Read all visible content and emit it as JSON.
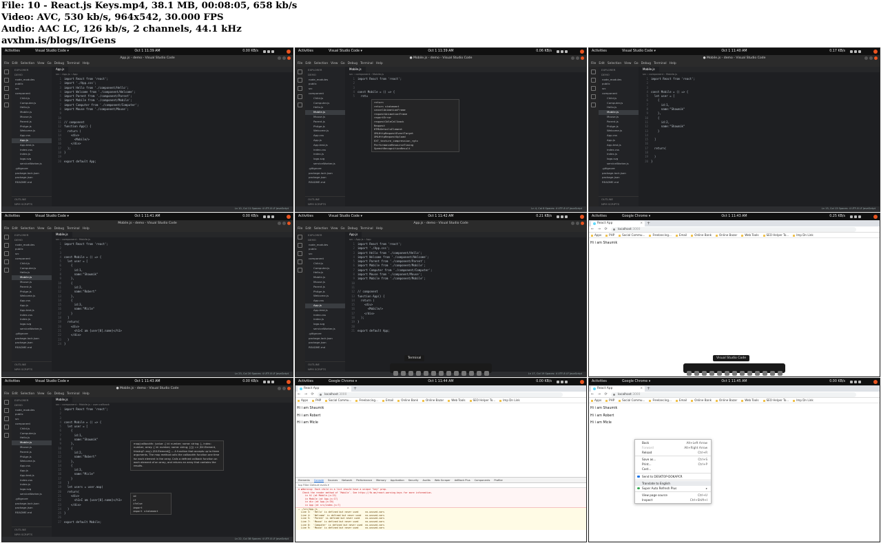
{
  "header": {
    "file": "File: 10 - React.js Keys.mp4, 38.1 MB, 00:08:05, 658 kb/s",
    "video": "Video: AVC, 530 kb/s, 964x542, 30.000 FPS",
    "audio": "Audio: AAC LC, 126 kb/s, 2 channels, 44.1 kHz",
    "site": "avxhm.is/blogs/IrGens"
  },
  "os": {
    "activities": "Activities",
    "vscode_app": "Visual Studio Code ▾",
    "chrome_app": "Google Chrome ▾"
  },
  "vscode": {
    "menu": [
      "File",
      "Edit",
      "Selection",
      "View",
      "Go",
      "Debug",
      "Terminal",
      "Help"
    ],
    "explorer_label": "EXPLORER",
    "outline": "OUTLINE",
    "npm_scripts": "NPM SCRIPTS"
  },
  "chrome": {
    "tab_title": "React App",
    "url_host": "localhost",
    "url_port": ":3000",
    "bookmarks": [
      "Apps",
      "PHP",
      "Social Commu...",
      "Freelancing...",
      "Email",
      "Online Bank",
      "Online Bazar",
      "Web Tools",
      "SEO Helper To...",
      "Imp Dn Link"
    ]
  },
  "t1": {
    "clock": "Oct 1 11:39 AM",
    "net": "0.00 KB/s",
    "title": "App.js - demo - Visual Studio Code",
    "tab": "App.js",
    "crumb": "src › App.js › App",
    "status": "Ln 10, Col 11   Spaces: 4   UTF-8   LF   JavaScript",
    "code": [
      "import React from 'react';",
      "import './App.css';",
      "import Hello from './component/Hello';",
      "import Welcome from './component/Welcome';",
      "import Parent from './component/Parent';",
      "import Mobile from './component/Mobile';",
      "import Computer from './component/Computer';",
      "import Mouse from './component/Mouse';",
      "",
      "",
      "// component",
      "function App() {",
      "  return (",
      "    <div>",
      "      <Mobile/>",
      "    </div>",
      "  );",
      "}",
      "",
      "export default App;"
    ]
  },
  "t2": {
    "clock": "Oct 1 11:39 AM",
    "net": "0.06 KB/s",
    "title": "● Mobile.js - demo - Visual Studio Code",
    "tab": "Mobile.js",
    "crumb": "src › component › Mobile.js",
    "status": "Ln 4, Col 6   Spaces: 4   UTF-8   LF   JavaScript",
    "code": [
      "import React from 'react';",
      "",
      "",
      "const Mobile = () => {",
      "  retu"
    ],
    "suggest": [
      "return",
      "return statement",
      "cancelAnimationFrame",
      "requestAnimationFrame",
      "reportError",
      "requestIdleCallback",
      "Request",
      "HTMLDetailsElement",
      "XMLHttpRequestEventTarget",
      "XMLHttpRequestUpload",
      "EXT_texture_compression_rgtc",
      "PerformanceResourceTiming",
      "SpeechRecognitionResult"
    ]
  },
  "t3": {
    "clock": "Oct 1 11:40 AM",
    "net": "0.17 KB/s",
    "title": "● Mobile.js - demo - Visual Studio Code",
    "tab": "Mobile.js",
    "crumb": "src › component › Mobile.js",
    "status": "Ln 13, Col 13   Spaces: 4   UTF-8   LF   JavaScript",
    "code": [
      "import React from 'react';",
      "",
      "",
      "const Mobile = () => {",
      "  let user = [",
      "    {",
      "      id:1,",
      "      name:\"Shaumik\"",
      "    },",
      "    {",
      "      id:2,",
      "      name:\"Shaumik\"",
      "    }",
      "",
      "  ]",
      "",
      "  return(",
      "",
      "  )",
      "}"
    ]
  },
  "t4": {
    "clock": "Oct 1 11:41 AM",
    "net": "0.00 KB/s",
    "title": "Mobile.js - demo - Visual Studio Code",
    "tab": "Mobile.js",
    "crumb": "src › component › Mobile.js",
    "status": "Ln 23, Col 20   Spaces: 4   UTF-8   LF   JavaScript",
    "code": [
      "import React from 'react';",
      "",
      "",
      "const Mobile = () => {",
      "  let user = [",
      "    {",
      "      id:1,",
      "      name:\"Shaumik\"",
      "    },",
      "    {",
      "      id:2,",
      "      name:\"Robert\"",
      "    },",
      "    {",
      "      id:3,",
      "      name:\"Micle\"",
      "    }",
      "  ]",
      "  return(",
      "    <div>",
      "      <h1>I am {user[0].name}</h1>",
      "    </div>",
      "  )",
      "}"
    ]
  },
  "t5": {
    "clock": "Oct 1 11:42 AM",
    "net": "0.21 KB/s",
    "title": "App.js - demo - Visual Studio Code",
    "tab": "App.js",
    "crumb": "src › App.js › App",
    "status": "Ln 17, Col 19   Spaces: 4   UTF-8   LF   JavaScript",
    "tooltip": "Terminal",
    "code": [
      "import React from 'react';",
      "import './App.css';",
      "import Hello from './component/Hello';",
      "import Welcome from './component/Welcome';",
      "import Parent from './component/Parent';",
      "import Mobile from './component/Mobile';",
      "import Computer from './component/Computer';",
      "import Mouse from './component/Mouse';",
      "import Mobile from './component/Mobile';",
      "",
      "",
      "// component",
      "function App() {",
      "  return (",
      "    <div>",
      "      <Mobile/>",
      "    </div>",
      "  );",
      "}",
      "",
      "export default App;"
    ]
  },
  "t6": {
    "clock": "Oct 1 11:43 AM",
    "net": "0.25 KB/s",
    "tooltip": "Visual Studio Code",
    "lines": [
      "Hi i am Shaumik"
    ]
  },
  "t7": {
    "clock": "Oct 1 11:43 AM",
    "net": "0.00 KB/s",
    "title": "● Mobile.js - demo - Visual Studio Code",
    "tab": "Mobile.js",
    "crumb": "src › component › Mobile.js › user.callback",
    "status": "Ln 22, Col 38   Spaces: 4   UTF-8   LF   JavaScript",
    "code": [
      "import React from 'react';",
      "",
      "",
      "const Mobile = () => {",
      "  let user = [",
      "    {",
      "      id:1,",
      "      name:\"Shaumik\"",
      "    },",
      "    {",
      "      id:2,",
      "      name:\"Robert\"",
      "    },",
      "    {",
      "      id:3,",
      "      name:\"Micle\"",
      "    }",
      "  ]",
      "  let users = user.map(",
      "  return(",
      "    <div>",
      "      <h1>I am {user[0].name}</h1>",
      "    </div>",
      "  )",
      "}",
      "",
      "export default Mobile;"
    ],
    "tip": "map(callbackfn: (value: { id: number; name: string; }, index: number, array: { id: number; name: string; }[]) => JSX.Element, thisArg?: any): JSX.Element[] — A function that accepts up to three arguments. The map method calls the callbackfn function one time for each element in the array. Calls a defined callback function on each element of an array, and returns an array that contains the results.",
    "suggest": [
      "id",
      "if",
      "ifelse",
      "import",
      "import statement"
    ]
  },
  "t8": {
    "clock": "Oct 1 11:44 AM",
    "net": "0.00 KB/s",
    "lines": [
      "Hi i am Shaumik",
      "Hi i am Robert",
      "Hi i am Micle"
    ],
    "devtools_tabs": [
      "Elements",
      "Console",
      "Sources",
      "Network",
      "Performance",
      "Memory",
      "Application",
      "Security",
      "Audits",
      "Web Scraper",
      "AdBlock Plus",
      "Components",
      "Profiler"
    ],
    "filter": "top          Filter                     Default levels ▾",
    "warn": [
      "⊗ ▶Warning: Each child in a list should have a unique \"key\" prop.",
      "   Check the render method of `Mobile`. See https://fb.me/react-warning-keys for more information.",
      "     in h1 (at Mobile.js:22)",
      "     in Mobile (at App.js:17)",
      "     in div (at App.js:16)",
      "     in App (at src/index.js:7)"
    ],
    "warn2": [
      "⚠ ./src/App.js",
      "  Line 3:  'Hello' is defined but never used     no-unused-vars",
      "  Line 4:  'Welcome' is defined but never used   no-unused-vars",
      "  Line 5:  'Parent' is defined but never used    no-unused-vars",
      "  Line 7:  'Mouse' is defined but never used     no-unused-vars",
      "  Line 8:  'Computer' is defined but never used  no-unused-vars",
      "  Line 9:  'Mouse' is defined but never used     no-unused-vars"
    ]
  },
  "t9": {
    "clock": "Oct 1 11:45 AM",
    "net": "0.00 KB/s",
    "lines": [
      "Hi i am Shaumik",
      "Hi i am Robert",
      "Hi i am Micle"
    ],
    "menu": [
      {
        "label": "Back",
        "sc": "Alt+Left Arrow"
      },
      {
        "label": "Forward",
        "sc": "Alt+Right Arrow",
        "dis": true
      },
      {
        "label": "Reload",
        "sc": "Ctrl+R"
      },
      {
        "sep": true
      },
      {
        "label": "Save as...",
        "sc": "Ctrl+S"
      },
      {
        "label": "Print...",
        "sc": "Ctrl+P"
      },
      {
        "label": "Cast...",
        "sc": ""
      },
      {
        "sep": true
      },
      {
        "label": "Send to DESKTOP-DOKAPCR",
        "sc": "",
        "icon": "b"
      },
      {
        "sep": true
      },
      {
        "label": "Translate to English",
        "sc": "",
        "hl": true
      },
      {
        "label": "Super Auto Refresh Plus",
        "sc": "▸",
        "icon": "r"
      },
      {
        "sep": true
      },
      {
        "label": "View page source",
        "sc": "Ctrl+U"
      },
      {
        "label": "Inspect",
        "sc": "Ctrl+Shift+I"
      }
    ]
  },
  "tree": {
    "demo": "DEMO",
    "items": [
      "node_modules",
      "public",
      "src",
      "component",
      "Child.js",
      "Computer.js",
      "Hello.js",
      "Mobile.js",
      "Mouse.js",
      "Parent.js",
      "PhAge.js",
      "Welcome.js",
      "App.css",
      "App.js",
      "App.test.js",
      "index.css",
      "index.js",
      "logo.svg",
      "serviceWorker.js",
      ".gitignore",
      "package-lock.json",
      "package.json",
      "README.md"
    ]
  },
  "colors": {
    "vscode_bg": "#1e1f22",
    "chrome_bg": "#ffffff",
    "ubuntu_orange": "#e95420"
  }
}
